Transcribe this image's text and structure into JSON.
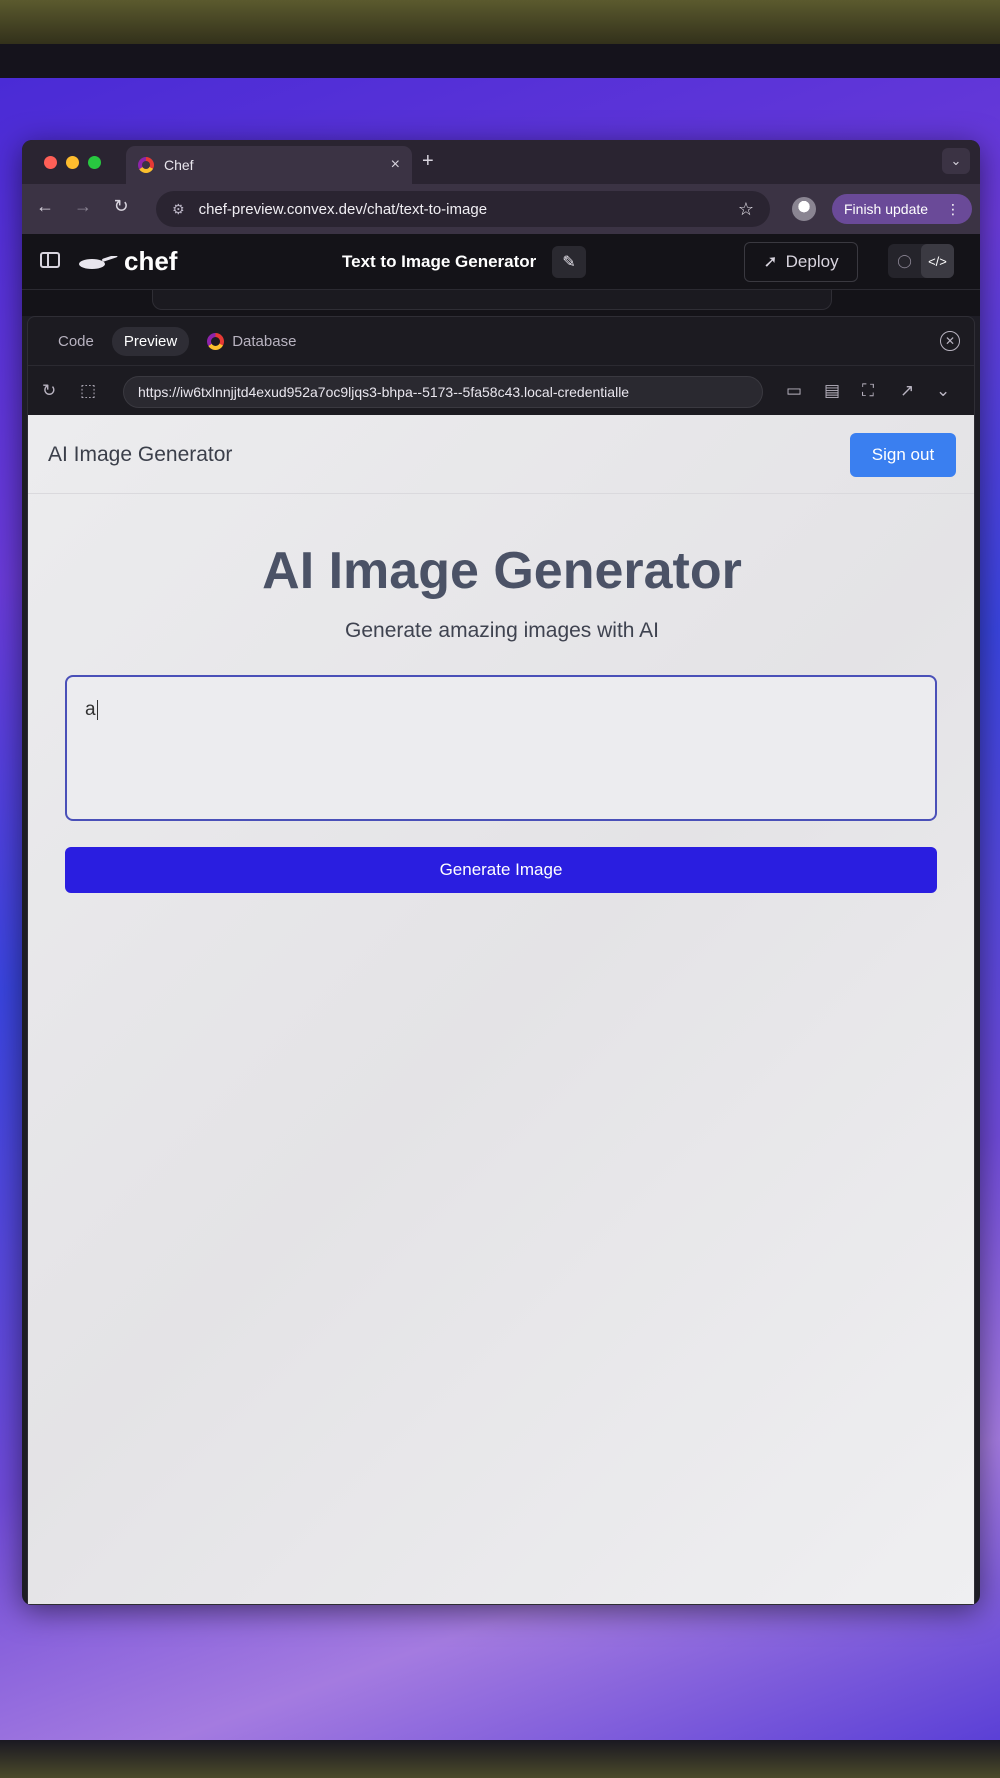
{
  "browser": {
    "tab_title": "Chef",
    "tab_close": "×",
    "new_tab": "+",
    "url": "chef-preview.convex.dev/chat/text-to-image",
    "finish_update_label": "Finish update",
    "menu_glyph": "⋮"
  },
  "app": {
    "logo_text": "chef",
    "project_title": "Text to Image Generator",
    "deploy_label": "Deploy"
  },
  "workbench": {
    "tabs": [
      {
        "label": "Code"
      },
      {
        "label": "Preview",
        "active": true
      },
      {
        "label": "Database"
      }
    ],
    "preview_url": "https://iw6txlnnjjtd4exud952a7oc9ljqs3-bhpa--5173--5fa58c43.local-credentialle"
  },
  "preview": {
    "brand": "AI Image Generator",
    "sign_out_label": "Sign out",
    "heading": "AI Image Generator",
    "subheading": "Generate amazing images with AI",
    "prompt_value": "a",
    "generate_label": "Generate Image"
  },
  "colors": {
    "sign_out_bg": "#3a7ff0",
    "generate_bg": "#2a1ee0",
    "prompt_border": "#4a50b8",
    "finish_update_bg": "#6a4a98"
  }
}
